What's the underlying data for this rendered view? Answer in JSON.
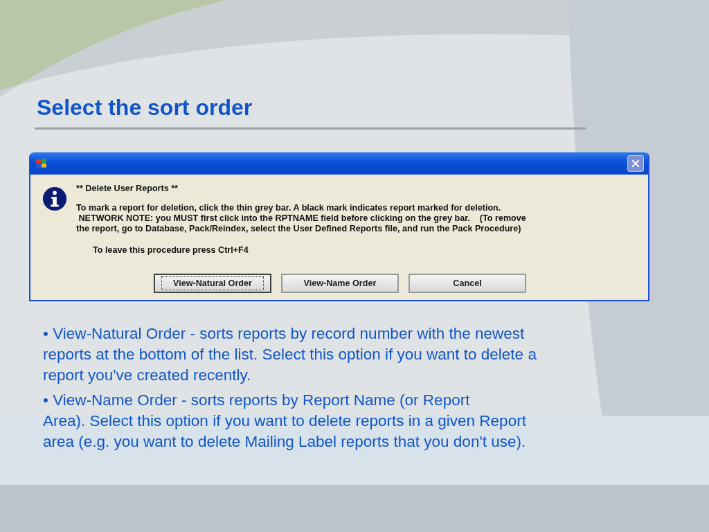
{
  "slide": {
    "title": "Select the sort order"
  },
  "dialog": {
    "heading": "** Delete User Reports **",
    "message_lines": [
      "To mark a report for deletion, click the thin grey bar. A black mark indicates report marked for deletion.",
      " NETWORK NOTE: you MUST first click into the RPTNAME field before clicking on the grey bar.    (To remove",
      "the report, go to Database, Pack/Reindex, select the User Defined Reports file, and run the Pack Procedure)"
    ],
    "hint": "To leave this procedure press Ctrl+F4",
    "buttons": [
      {
        "label": "View-Natural Order",
        "focused": true
      },
      {
        "label": "View-Name Order",
        "focused": false
      },
      {
        "label": "Cancel",
        "focused": false
      }
    ]
  },
  "bullets": [
    {
      "lines": [
        "• View-Natural Order - sorts reports by record number with the newest",
        "reports at the bottom of the list.  Select this option if you want to delete a",
        "report you've created recently."
      ]
    },
    {
      "lines": [
        "• View-Name Order - sorts reports by Report Name (or Report",
        "Area).  Select this option if you want to delete reports in a given Report",
        "area (e.g. you want to delete Mailing Label reports that you don't use)."
      ]
    }
  ]
}
